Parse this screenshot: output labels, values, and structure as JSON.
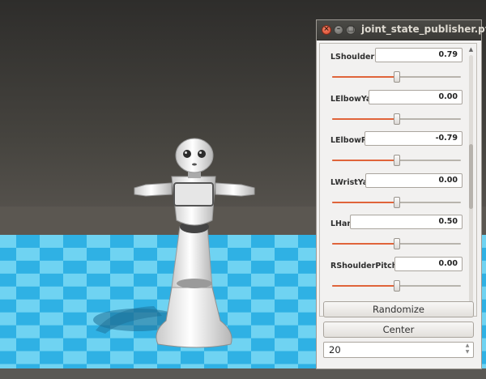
{
  "window": {
    "title": "joint_state_publisher.py",
    "close_glyph": "×",
    "minimize_glyph": "–",
    "maximize_glyph": "□"
  },
  "joints": [
    {
      "label": "LShoulderRoll",
      "value": "0.79",
      "slider_fraction": 0.5
    },
    {
      "label": "LElbowYaw",
      "value": "0.00",
      "slider_fraction": 0.5
    },
    {
      "label": "LElbowRoll",
      "value": "-0.79",
      "slider_fraction": 0.5
    },
    {
      "label": "LWristYaw",
      "value": "0.00",
      "slider_fraction": 0.5
    },
    {
      "label": "LHand",
      "value": "0.50",
      "slider_fraction": 0.5
    },
    {
      "label": "RShoulderPitch",
      "value": "0.00",
      "slider_fraction": 0.5
    }
  ],
  "buttons": {
    "randomize": "Randomize",
    "center": "Center"
  },
  "spinbox": {
    "value": "20"
  },
  "colors": {
    "slider_fill": "#e0643a",
    "sky": "#3d3c3a",
    "floor_light": "#6fd3f2",
    "floor_dark": "#2aa9de"
  },
  "icons": {
    "scroll_up": "up-arrow-icon",
    "scroll_down": "down-arrow-icon"
  }
}
